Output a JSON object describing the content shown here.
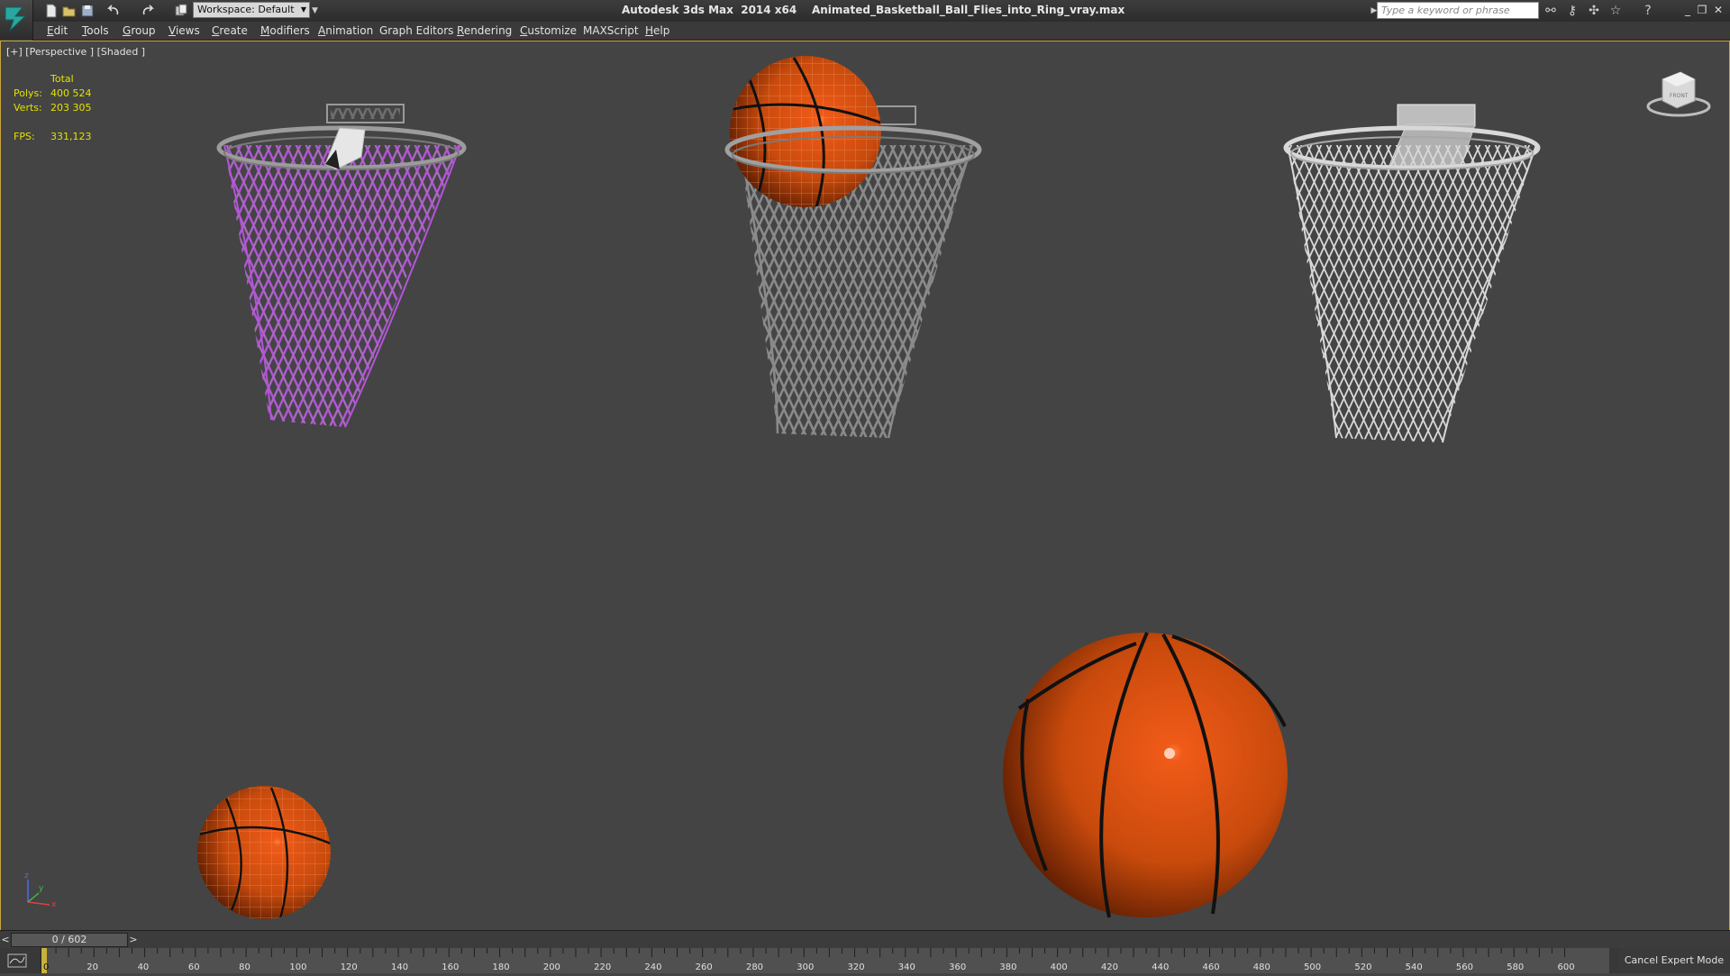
{
  "titlebar": {
    "app_title": "Autodesk 3ds Max  2014 x64",
    "file_name": "Animated_Basketball_Ball_Flies_into_Ring_vray.max",
    "workspace_label": "Workspace: Default",
    "search_placeholder": "Type a keyword or phrase",
    "window_controls": [
      "_",
      "❐",
      "✕"
    ]
  },
  "quick_access_icons": [
    "app-logo-icon",
    "new-file-icon",
    "open-file-icon",
    "save-icon",
    "undo-icon",
    "redo-icon",
    "project-folder-icon"
  ],
  "menu": [
    {
      "label": "Edit",
      "ul": "E",
      "rest": "dit"
    },
    {
      "label": "Tools",
      "ul": "T",
      "rest": "ools"
    },
    {
      "label": "Group",
      "ul": "G",
      "rest": "roup"
    },
    {
      "label": "Views",
      "ul": "V",
      "rest": "iews"
    },
    {
      "label": "Create",
      "ul": "C",
      "rest": "reate"
    },
    {
      "label": "Modifiers",
      "ul": "M",
      "rest": "odifiers"
    },
    {
      "label": "Animation",
      "ul": "A",
      "rest": "nimation"
    },
    {
      "label": "Graph Editors",
      "ul": "Graph E",
      "rest": "ditors"
    },
    {
      "label": "Rendering",
      "ul": "R",
      "rest": "endering"
    },
    {
      "label": "Customize",
      "ul": "C",
      "rest": "ustomize"
    },
    {
      "label": "MAXScript",
      "ul": "MAX",
      "rest": "Script"
    },
    {
      "label": "Help",
      "ul": "H",
      "rest": "elp"
    }
  ],
  "viewport": {
    "label": "[+] [Perspective ] [Shaded ]",
    "stats": {
      "total_label": "Total",
      "polys_label": "Polys:",
      "polys_value": "400 524",
      "verts_label": "Verts:",
      "verts_value": "203 305",
      "fps_label": "FPS:",
      "fps_value": "331,123"
    },
    "viewcube_face": "FRONT",
    "axis_labels": [
      "x",
      "y",
      "z"
    ]
  },
  "timeline": {
    "frame_display": "0 / 602",
    "prev_label": "<",
    "next_label": ">",
    "ticks": [
      20,
      40,
      60,
      80,
      100,
      120,
      140,
      160,
      180,
      200,
      220,
      240,
      260,
      280,
      300,
      320,
      340,
      360,
      380,
      400,
      420,
      440,
      460,
      480,
      500,
      520,
      540,
      560,
      580,
      600
    ],
    "first_tick": "0"
  },
  "cancel_expert_label": "Cancel Expert Mode",
  "colors": {
    "viewport_bg": "#444444",
    "active_border": "#c9a43a",
    "stats_text": "#e2e200",
    "ball_orange": "#d2520c",
    "net_purple": "#b454d8",
    "net_grey": "#8c8c8c",
    "net_white": "#d0d0d0"
  }
}
